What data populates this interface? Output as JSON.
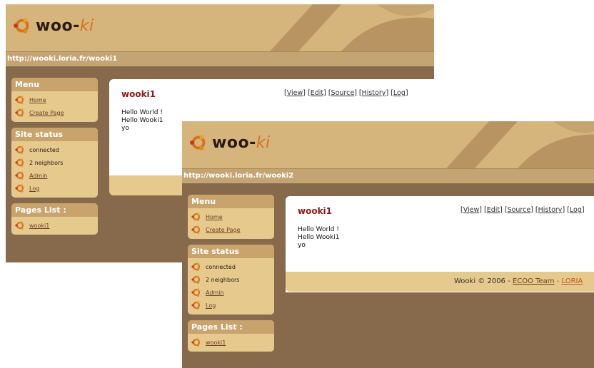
{
  "windows": [
    {
      "logo": {
        "prefix": "woo",
        "hyphen": "-",
        "suffix": "ki"
      },
      "url": "http://wooki.loria.fr/wooki1",
      "menu": {
        "title": "Menu",
        "items": [
          "Home",
          "Create Page"
        ]
      },
      "site_status": {
        "title": "Site status",
        "items": [
          "connected",
          "2 neighbors",
          "Admin",
          "Log"
        ]
      },
      "pages_list": {
        "title": "Pages List :",
        "items": [
          "wooki1"
        ]
      },
      "page": {
        "title": "wooki1",
        "tabs": [
          "View",
          "Edit",
          "Source",
          "History",
          "Log"
        ],
        "lines": [
          "Hello World !",
          "Hello Wooki1",
          "yo"
        ]
      }
    },
    {
      "logo": {
        "prefix": "woo",
        "hyphen": "-",
        "suffix": "ki"
      },
      "url": "http://wooki.loria.fr/wooki2",
      "menu": {
        "title": "Menu",
        "items": [
          "Home",
          "Create Page"
        ]
      },
      "site_status": {
        "title": "Site status",
        "items": [
          "connected",
          "2 neighbors",
          "Admin",
          "Log"
        ]
      },
      "pages_list": {
        "title": "Pages List :",
        "items": [
          "wooki1"
        ]
      },
      "page": {
        "title": "wooki1",
        "tabs": [
          "View",
          "Edit",
          "Source",
          "History",
          "Log"
        ],
        "lines": [
          "Hello World !",
          "Hello Wooki1",
          "yo"
        ]
      },
      "footer": {
        "text": "Wooki © 2006 - ",
        "team": "ECOO Team",
        "sep": " - ",
        "org": "LORIA"
      }
    }
  ],
  "colors": {
    "background": "#876a4b",
    "banner": "#d6b57d",
    "box": "#e6c98d",
    "title_red": "#8b1a1a",
    "logo_orange": "#d8731c"
  },
  "icons": {
    "logo": "ubuntu-circle-icon",
    "list_bullet": "ubuntu-circle-icon"
  }
}
